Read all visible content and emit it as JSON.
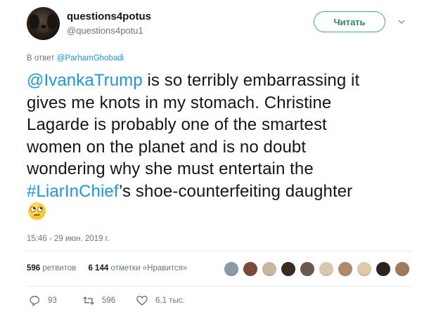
{
  "user": {
    "name": "questions4potus",
    "handle": "@questions4potu1"
  },
  "follow_label": "Читать",
  "reply_to": {
    "prefix": "В ответ",
    "target": "@ParhamGhobadi"
  },
  "tweet": {
    "mention": "@IvankaTrump",
    "line1_rest": " is so terribly embarrassing it",
    "line2": "gives me knots in my stomach. Christine",
    "line3": "Lagarde is probably one of the smartest",
    "line4": "women on the planet and is no doubt",
    "line5": "wondering why she must entertain the",
    "hashtag": "#LiarInChief",
    "line6_rest": "’s shoe-counterfeiting daughter",
    "emoji": "face-with-rolling-eyes"
  },
  "timestamp": "15:46 - 29 июн. 2019 г.",
  "stats": {
    "retweets_count": "596",
    "retweets_label": "ретвитов",
    "likes_count": "6 144",
    "likes_label": "отметки «Нравится»"
  },
  "likers_colors": [
    "#8a9aa6",
    "#7a4a3a",
    "#c9b7a0",
    "#3a2a22",
    "#6b5a4c",
    "#d8c8b0",
    "#b08a6a",
    "#e0c9a8",
    "#2a2420",
    "#a07a5a"
  ],
  "actions": {
    "reply_count": "93",
    "retweet_count": "596",
    "like_count": "6,1 тыс."
  },
  "colors": {
    "link": "#1b95e0",
    "muted": "#657786",
    "text": "#14171a",
    "follow_border": "#4aa889"
  }
}
